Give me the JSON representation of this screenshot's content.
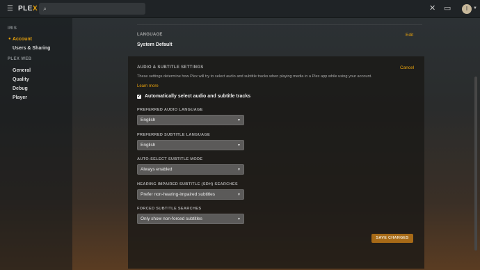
{
  "topbar": {
    "brand_icon": "hamburger-icon",
    "logo": "PLEX",
    "search": {
      "placeholder": "",
      "value": ""
    },
    "icons": [
      "tools-icon",
      "cast-icon",
      "settings-icon"
    ],
    "avatar_initial": "I"
  },
  "sidebar": {
    "section1": "IRIS",
    "items1": [
      "Account",
      "Users & Sharing"
    ],
    "section2": "PLEX WEB",
    "items2": [
      "General",
      "Quality",
      "Debug",
      "Player"
    ]
  },
  "language": {
    "title": "LANGUAGE",
    "edit": "Edit",
    "value": "System Default"
  },
  "panel": {
    "title": "AUDIO & SUBTITLE SETTINGS",
    "cancel": "Cancel",
    "description": "These settings determine how Plex will try to select audio and subtitle tracks when playing media in a Plex app while using your account.",
    "learn_more": "Learn more",
    "auto_select_label": "Automatically select audio and subtitle tracks",
    "fields": [
      {
        "label": "PREFERRED AUDIO LANGUAGE",
        "value": "English"
      },
      {
        "label": "PREFERRED SUBTITLE LANGUAGE",
        "value": "English"
      },
      {
        "label": "AUTO-SELECT SUBTITLE MODE",
        "value": "Always enabled"
      },
      {
        "label": "HEARING IMPAIRED SUBTITLE (SDH) SEARCHES",
        "value": "Prefer non-hearing-impaired subtitles"
      },
      {
        "label": "FORCED SUBTITLE SEARCHES",
        "value": "Only show non-forced subtitles"
      }
    ],
    "save": "SAVE CHANGES"
  },
  "colors": {
    "accent": "#e5a00d",
    "save_bg": "#a76a17"
  }
}
